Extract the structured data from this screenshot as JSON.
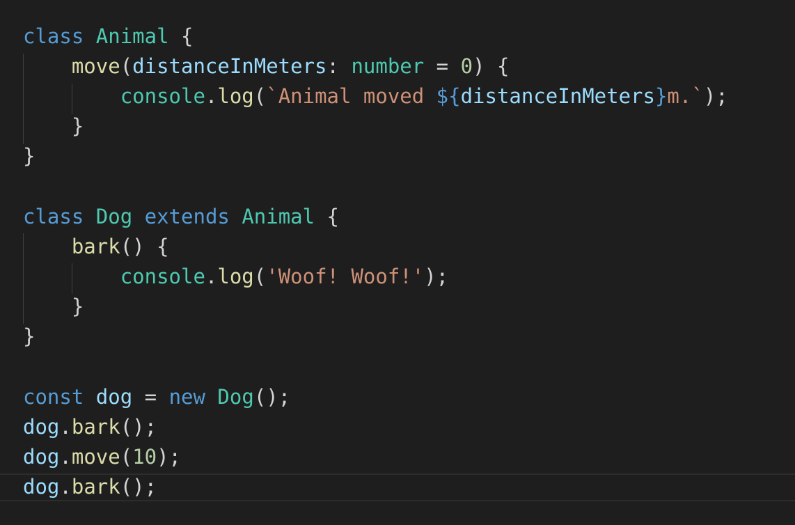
{
  "editor": {
    "language": "TypeScript",
    "colors": {
      "background": "#1e1e1e",
      "keyword": "#569cd6",
      "class": "#4ec9b0",
      "function": "#dcdcaa",
      "variable": "#9cdcfe",
      "string": "#ce9178",
      "number": "#b5cea8",
      "punctuation": "#d4d4d4"
    },
    "lines": [
      [
        [
          "kw",
          "class"
        ],
        [
          "punc",
          " "
        ],
        [
          "cls",
          "Animal"
        ],
        [
          "punc",
          " {"
        ]
      ],
      [
        [
          "punc",
          "    "
        ],
        [
          "fn",
          "move"
        ],
        [
          "punc",
          "("
        ],
        [
          "var",
          "distanceInMeters"
        ],
        [
          "punc",
          ": "
        ],
        [
          "cls",
          "number"
        ],
        [
          "punc",
          " = "
        ],
        [
          "num",
          "0"
        ],
        [
          "punc",
          ") {"
        ]
      ],
      [
        [
          "punc",
          "        "
        ],
        [
          "cls",
          "console"
        ],
        [
          "punc",
          "."
        ],
        [
          "fn",
          "log"
        ],
        [
          "punc",
          "("
        ],
        [
          "str",
          "`Animal moved "
        ],
        [
          "tmpl",
          "${"
        ],
        [
          "var",
          "distanceInMeters"
        ],
        [
          "tmpl",
          "}"
        ],
        [
          "str",
          "m.`"
        ],
        [
          "punc",
          ");"
        ]
      ],
      [
        [
          "punc",
          "    }"
        ]
      ],
      [
        [
          "punc",
          "}"
        ]
      ],
      [],
      [
        [
          "kw",
          "class"
        ],
        [
          "punc",
          " "
        ],
        [
          "cls",
          "Dog"
        ],
        [
          "punc",
          " "
        ],
        [
          "kw",
          "extends"
        ],
        [
          "punc",
          " "
        ],
        [
          "cls",
          "Animal"
        ],
        [
          "punc",
          " {"
        ]
      ],
      [
        [
          "punc",
          "    "
        ],
        [
          "fn",
          "bark"
        ],
        [
          "punc",
          "() {"
        ]
      ],
      [
        [
          "punc",
          "        "
        ],
        [
          "cls",
          "console"
        ],
        [
          "punc",
          "."
        ],
        [
          "fn",
          "log"
        ],
        [
          "punc",
          "("
        ],
        [
          "str",
          "'Woof! Woof!'"
        ],
        [
          "punc",
          ");"
        ]
      ],
      [
        [
          "punc",
          "    }"
        ]
      ],
      [
        [
          "punc",
          "}"
        ]
      ],
      [],
      [
        [
          "kw",
          "const"
        ],
        [
          "punc",
          " "
        ],
        [
          "var",
          "dog"
        ],
        [
          "punc",
          " = "
        ],
        [
          "kw",
          "new"
        ],
        [
          "punc",
          " "
        ],
        [
          "cls",
          "Dog"
        ],
        [
          "punc",
          "();"
        ]
      ],
      [
        [
          "var",
          "dog"
        ],
        [
          "punc",
          "."
        ],
        [
          "fn",
          "bark"
        ],
        [
          "punc",
          "();"
        ]
      ],
      [
        [
          "var",
          "dog"
        ],
        [
          "punc",
          "."
        ],
        [
          "fn",
          "move"
        ],
        [
          "punc",
          "("
        ],
        [
          "num",
          "10"
        ],
        [
          "punc",
          ");"
        ]
      ],
      [
        [
          "var",
          "dog"
        ],
        [
          "punc",
          "."
        ],
        [
          "fn",
          "bark"
        ],
        [
          "punc",
          "();"
        ]
      ]
    ]
  }
}
